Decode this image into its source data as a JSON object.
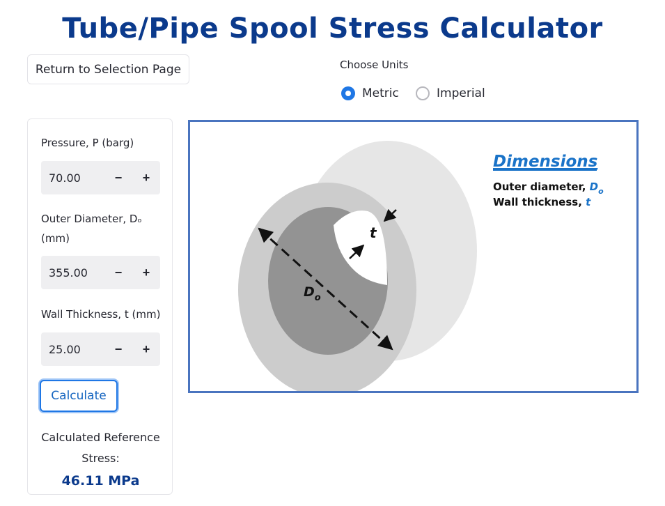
{
  "page": {
    "title": "Tube/Pipe Spool Stress Calculator"
  },
  "nav": {
    "return_label": "Return to Selection Page"
  },
  "units": {
    "label": "Choose Units",
    "options": [
      {
        "label": "Metric",
        "selected": true
      },
      {
        "label": "Imperial",
        "selected": false
      }
    ]
  },
  "inputs": {
    "pressure": {
      "label": "Pressure, P (barg)",
      "value": "70.00"
    },
    "outer_diameter": {
      "label_line1": "Outer Diameter, Dₒ",
      "label_line2": "(mm)",
      "value": "355.00"
    },
    "wall_thickness": {
      "label": "Wall Thickness, t (mm)",
      "value": "25.00"
    },
    "minus": "−",
    "plus": "+"
  },
  "actions": {
    "calculate_label": "Calculate"
  },
  "result": {
    "label_line1": "Calculated Reference",
    "label_line2": "Stress:",
    "value": "46.11 MPa"
  },
  "diagram": {
    "heading": "Dimensions",
    "outer_diameter_text": "Outer diameter, ",
    "outer_diameter_symbol": "D",
    "outer_diameter_sub": "o",
    "wall_thickness_text": "Wall thickness, ",
    "wall_thickness_symbol": "t",
    "label_t": "t",
    "label_D": "D",
    "label_D_sub": "o",
    "colors": {
      "accent": "#1a73c8",
      "border": "#4a74bf"
    }
  }
}
